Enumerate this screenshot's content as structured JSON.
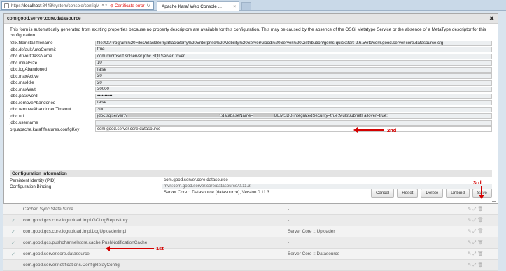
{
  "browser": {
    "address_prefix": "https://",
    "address_host": "localhost",
    "address_rest": ":8443/system/console/configM",
    "search_glyph": "⌕ ▾",
    "cert_error": "⊘ Certificate error",
    "refresh_glyph": "↻",
    "tab_title": "Apache Karaf Web Console ...",
    "tab_close": "×"
  },
  "dialog": {
    "title": "com.good.server.core.datasource",
    "close": "✖",
    "description": "This form is automatically generated from existing properties because no property descriptors are available for this configuration. This may be caused by the absence of the OSGi Metatype Service or the absence of a MetaType descriptor for this configuration.",
    "properties": [
      {
        "label": "felix.fileinstall.filename",
        "value": "file:/D:/Program%20Files/BlackBerry/BlackBerry%20Enterprise%20Mobility%20Server/Good%20Server%20Distribution/gems-quickstart-2.6.5/etc/com.good.server.core.datasource.cfg"
      },
      {
        "label": "jdbc.defaultAutoCommit",
        "value": "true"
      },
      {
        "label": "jdbc.driverClassName",
        "value": "com.microsoft.sqlserver.jdbc.SQLServerDriver"
      },
      {
        "label": "jdbc.initialSize",
        "value": "10"
      },
      {
        "label": "jdbc.logAbandoned",
        "value": "false"
      },
      {
        "label": "jdbc.maxActive",
        "value": "20"
      },
      {
        "label": "jdbc.maxIdle",
        "value": "20"
      },
      {
        "label": "jdbc.maxWait",
        "value": "30000"
      },
      {
        "label": "jdbc.password",
        "value": "••••••••••"
      },
      {
        "label": "jdbc.removeAbandoned",
        "value": "false"
      },
      {
        "label": "jdbc.removeAbandonedTimeout",
        "value": "300"
      }
    ],
    "url_label": "jdbc.url",
    "url_prefix": "jdbc:sqlserver://",
    "url_mid": "\\;databaseName=",
    "url_suffix": "BEMSDB;integratedSecurity=true;MultiSubnetFailover=true;",
    "username_label": "jdbc.username",
    "username_value": "",
    "features_label": "org.apache.karaf.features.configKey",
    "features_value": "com.good.server.core.datasource",
    "config_info_title": "Configuration Information",
    "pid_label": "Persistent Identity (PID)",
    "pid_value": "com.good.server.core.datasource",
    "binding_label": "Configuration Binding",
    "binding_value": "mvn:com.good.server.core/datasource/0.11.3",
    "binding_bundle": "Server Core :: Datasource (datasource), Version 0.11.3",
    "buttons": {
      "cancel": "Cancel",
      "reset": "Reset",
      "delete": "Delete",
      "unbind": "Unbind",
      "save": "Save"
    }
  },
  "list": {
    "rows": [
      {
        "check": "",
        "name": "Cached Sync State Store",
        "bundle": "-"
      },
      {
        "check": "✓",
        "name": "com.good.gcs.core.logupload.impl.GCLogRepository",
        "bundle": "-"
      },
      {
        "check": "✓",
        "name": "com.good.gcs.core.logupload.impl.LogUploaderImpl",
        "bundle": "Server Core :: Uploader"
      },
      {
        "check": "✓",
        "name": "com.good.gcs.pushchannelstore.cache.PushNotificationCache",
        "bundle": "-"
      },
      {
        "check": "✓",
        "name": "com.good.server.core.datasource",
        "bundle": "Server Core :: Datasource"
      },
      {
        "check": "",
        "name": "com.good.server.notifications.ConfigRelayConfig",
        "bundle": "-"
      }
    ],
    "action_glyphs": "✎ ⤢ 🗑"
  },
  "annotations": {
    "first": "1st",
    "second": "2nd",
    "third": "3rd"
  },
  "colors": {
    "annotation": "#d40000",
    "accent_bar": "#c9d9e8"
  }
}
